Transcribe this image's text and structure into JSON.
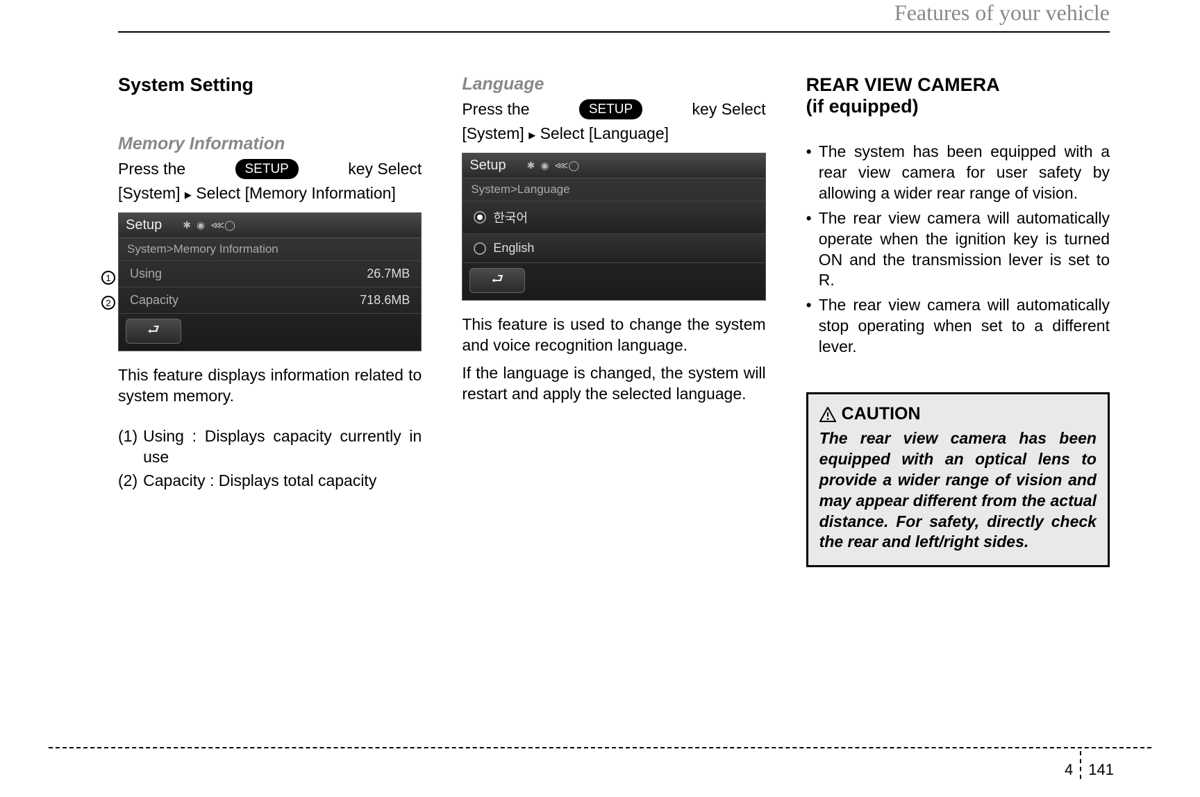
{
  "header": {
    "title": "Features of your vehicle"
  },
  "col1": {
    "title": "System Setting",
    "memory": {
      "heading": "Memory Information",
      "press_the": "Press   the",
      "setup": "SETUP",
      "key_select": "key   Select",
      "line2": "[System]   Select [Memory Information]",
      "screenshot": {
        "title": "Setup",
        "breadcrumb": "System>Memory Information",
        "rows": [
          {
            "label": "Using",
            "value": "26.7MB"
          },
          {
            "label": "Capacity",
            "value": "718.6MB"
          }
        ],
        "callouts": [
          "1",
          "2"
        ]
      },
      "desc": "This feature displays information related to system memory.",
      "list": [
        {
          "n": "(1)",
          "t": "Using : Displays capacity currently in use"
        },
        {
          "n": "(2)",
          "t": "Capacity : Displays total capacity"
        }
      ]
    }
  },
  "col2": {
    "heading": "Language",
    "press_the": "Press   the",
    "setup": "SETUP",
    "key_select": "key   Select",
    "line2": "[System]   Select [Language]",
    "screenshot": {
      "title": "Setup",
      "breadcrumb": "System>Language",
      "options": [
        {
          "label": "한국어",
          "selected": true
        },
        {
          "label": "English",
          "selected": false
        }
      ]
    },
    "desc1": "This feature is used to change the system and voice recognition language.",
    "desc2": "If the language is changed, the system will restart and apply the selected language."
  },
  "col3": {
    "title_l1": "REAR VIEW CAMERA",
    "title_l2": "(if equipped)",
    "bullets": [
      "The system has been equipped with a rear view camera for user safety by allowing a wider rear range of vision.",
      "The rear view camera will automatically operate when the ignition key is turned ON and the transmission lever is set to R.",
      "The rear view camera will automatically stop operating when set to a different lever."
    ],
    "caution": {
      "heading": "CAUTION",
      "body": "The rear view camera has been equipped with an optical lens to provide a wider range of vision and may appear different from the actual distance. For safety, directly check the rear and left/right sides."
    }
  },
  "footer": {
    "chapter": "4",
    "page": "141"
  }
}
